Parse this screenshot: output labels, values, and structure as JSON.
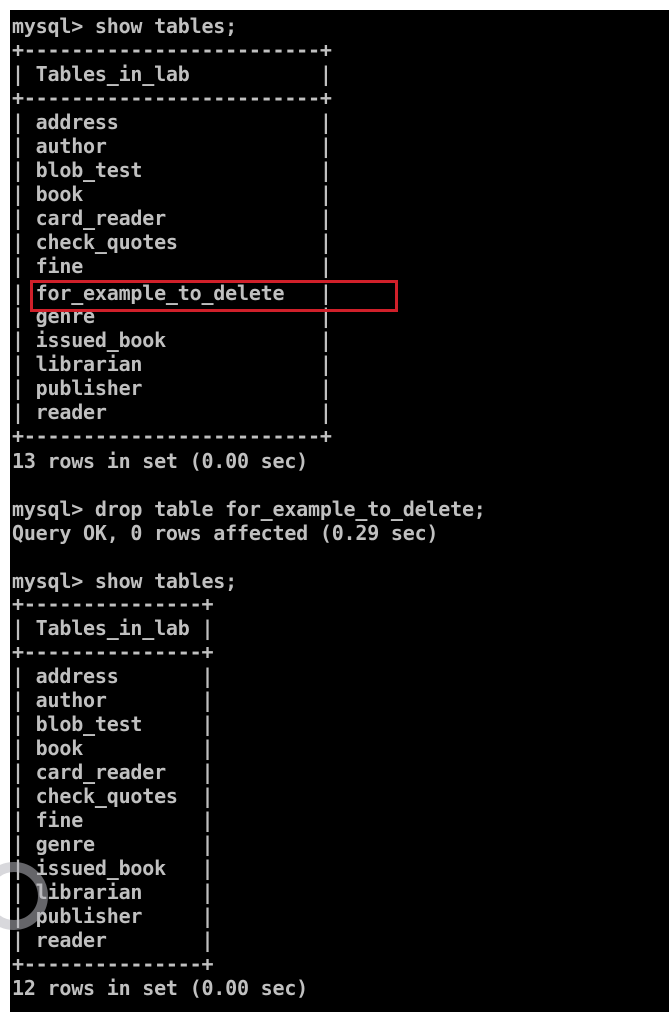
{
  "terminal": {
    "background": "#000000",
    "text_color": "#c0c0c0",
    "highlight_color": "#d0202a",
    "lines": [
      "mysql> show tables;",
      "+-------------------------+",
      "| Tables_in_lab           |",
      "+-------------------------+",
      "| address                 |",
      "| author                  |",
      "| blob_test               |",
      "| book                    |",
      "| card_reader             |",
      "| check_quotes            |",
      "| fine                    |",
      "| for_example_to_delete   |",
      "| genre                   |",
      "| issued_book             |",
      "| librarian               |",
      "| publisher               |",
      "| reader                  |",
      "+-------------------------+",
      "13 rows in set (0.00 sec)",
      "",
      "mysql> drop table for_example_to_delete;",
      "Query OK, 0 rows affected (0.29 sec)",
      "",
      "mysql> show tables;",
      "+---------------+",
      "| Tables_in_lab |",
      "+---------------+",
      "| address       |",
      "| author        |",
      "| blob_test     |",
      "| book          |",
      "| card_reader   |",
      "| check_quotes  |",
      "| fine          |",
      "| genre         |",
      "| issued_book   |",
      "| librarian     |",
      "| publisher     |",
      "| reader        |",
      "+---------------+",
      "12 rows in set (0.00 sec)"
    ]
  }
}
